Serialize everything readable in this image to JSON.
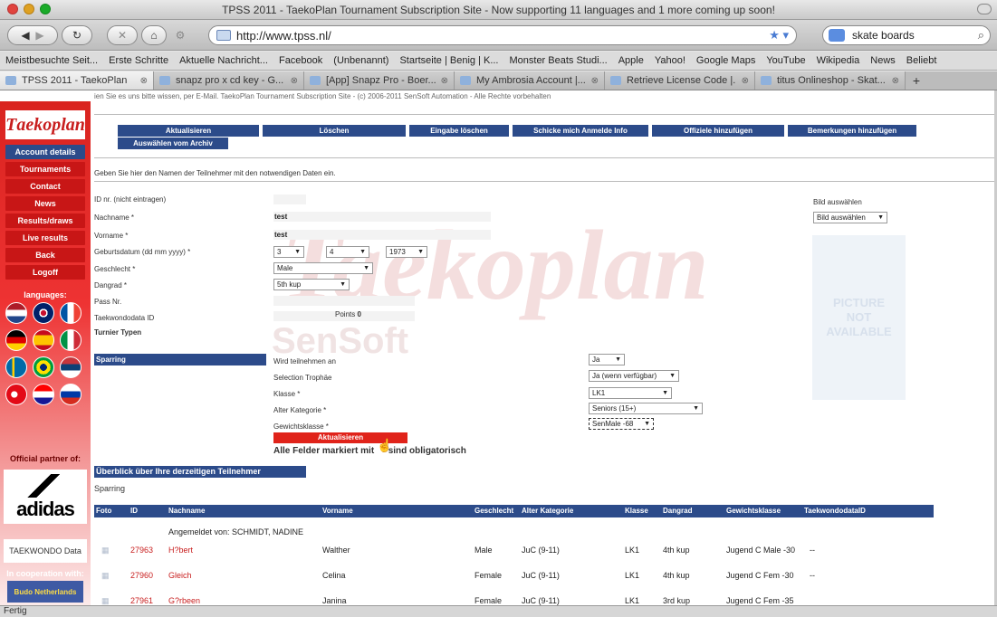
{
  "window": {
    "title": "TPSS 2011 - TaekoPlan Tournament Subscription Site - Now supporting 11 languages and 1 more coming up soon!"
  },
  "nav": {
    "url": "http://www.tpss.nl/",
    "search_value": "skate boards"
  },
  "bookmarks": [
    "Meistbesuchte Seit...",
    "Erste Schritte",
    "Aktuelle Nachricht...",
    "Facebook",
    "(Unbenannt)",
    "Startseite | Benig | K...",
    "Monster Beats Studi...",
    "Apple",
    "Yahoo!",
    "Google Maps",
    "YouTube",
    "Wikipedia",
    "News",
    "Beliebt"
  ],
  "tabs": [
    {
      "label": "TPSS 2011 - TaekoPlan",
      "active": true
    },
    {
      "label": "snapz pro x cd key - G..."
    },
    {
      "label": "[App] Snapz Pro - Boer..."
    },
    {
      "label": "My Ambrosia Account |..."
    },
    {
      "label": "Retrieve License Code |..."
    },
    {
      "label": "titus Onlineshop - Skat..."
    }
  ],
  "page_notice": "ien Sie es uns bitte wissen, per E-Mail. TaekoPlan Tournament Subscription Site - (c) 2006-2011 SenSoft Automation - Alle Rechte vorbehalten",
  "watermark": {
    "big": "Taekoplan",
    "small": "SenSoft"
  },
  "sidebar": {
    "logo": "aekoplan",
    "menu": [
      "Account details",
      "Tournaments",
      "Contact",
      "News",
      "Results/draws",
      "Live results",
      "Back",
      "Logoff"
    ],
    "languages_label": "languages:",
    "partner_label": "Official partner of:",
    "adidas": "adidas",
    "tkd_logo": "TAEKWONDO Data",
    "coop_label": "In cooperation with:",
    "judo_logo": "Budo Netherlands"
  },
  "toolbar": {
    "aktualisieren": "Aktualisieren",
    "loeschen": "Löschen",
    "eingabe_loeschen": "Eingabe löschen",
    "schicke": "Schicke mich Anmelde Info",
    "offizielle": "Offiziele hinzufügen",
    "bemerkungen": "Bemerkungen hinzufügen",
    "archiv": "Auswählen vom Archiv"
  },
  "form": {
    "info": "Geben Sie hier den Namen der Teilnehmer mit den notwendigen Daten ein.",
    "id_label": "ID nr. (nicht eintragen)",
    "nachname_label": "Nachname *",
    "nachname_value": "test",
    "vorname_label": "Vorname *",
    "vorname_value": "test",
    "geburt_label": "Geburtsdatum (dd mm yyyy) *",
    "geburt_day": "3",
    "geburt_month": "4",
    "geburt_year": "1973",
    "geschlecht_label": "Geschlecht *",
    "geschlecht_value": "Male",
    "dangrad_label": "Dangrad *",
    "dangrad_value": "5th kup",
    "pass_label": "Pass Nr.",
    "tkddata_label": "Taekwondodata ID",
    "points_label": "Points",
    "points_value": "0",
    "turnier_label": "Turnier Typen",
    "bild_label": "Bild auswählen",
    "bild_select": "Bild auswählen",
    "picture_text": [
      "PICTURE",
      "NOT",
      "AVAILABLE"
    ]
  },
  "sparring": {
    "header": "Sparring",
    "wird_label": "Wird teilnehmen an",
    "wird_value": "Ja",
    "selection_label": "Selection Trophäe",
    "selection_value": "Ja (wenn verfügbar)",
    "klasse_label": "Klasse *",
    "klasse_value": "LK1",
    "alter_label": "Alter Kategorie *",
    "alter_value": "Seniors (15+)",
    "gewicht_label": "Gewichtsklasse *",
    "gewicht_value": "SenMale -68",
    "submit": "Aktualisieren",
    "mandatory_pre": "Alle Felder markiert mit",
    "mandatory_post": "sind obligatorisch"
  },
  "overview": {
    "header": "Überblick über Ihre derzeitigen Teilnehmer",
    "section": "Sparring",
    "columns": [
      "Foto",
      "ID",
      "Nachname",
      "Vorname",
      "Geschlecht",
      "Alter Kategorie",
      "Klasse",
      "Dangrad",
      "Gewichtsklasse",
      "TaekwondodataID"
    ],
    "registered_by": "Angemeldet von: SCHMIDT, NADINE",
    "rows": [
      {
        "id": "27963",
        "nachname": "H?bert",
        "vorname": "Walther",
        "geschlecht": "Male",
        "alter": "JuC (9-11)",
        "klasse": "LK1",
        "dangrad": "4th kup",
        "gewicht": "Jugend C Male -30",
        "tkdid": "--"
      },
      {
        "id": "27960",
        "nachname": "Gleich",
        "vorname": "Celina",
        "geschlecht": "Female",
        "alter": "JuC (9-11)",
        "klasse": "LK1",
        "dangrad": "4th kup",
        "gewicht": "Jugend C Fem -30",
        "tkdid": "--"
      },
      {
        "id": "27961",
        "nachname": "G?rbeen",
        "vorname": "Janina",
        "geschlecht": "Female",
        "alter": "JuC (9-11)",
        "klasse": "LK1",
        "dangrad": "3rd kup",
        "gewicht": "Jugend C Fem -35",
        "tkdid": ""
      }
    ]
  },
  "status": "Fertig",
  "colors": {
    "brand_red": "#c81e1e",
    "nav_blue": "#2c4b8a"
  }
}
